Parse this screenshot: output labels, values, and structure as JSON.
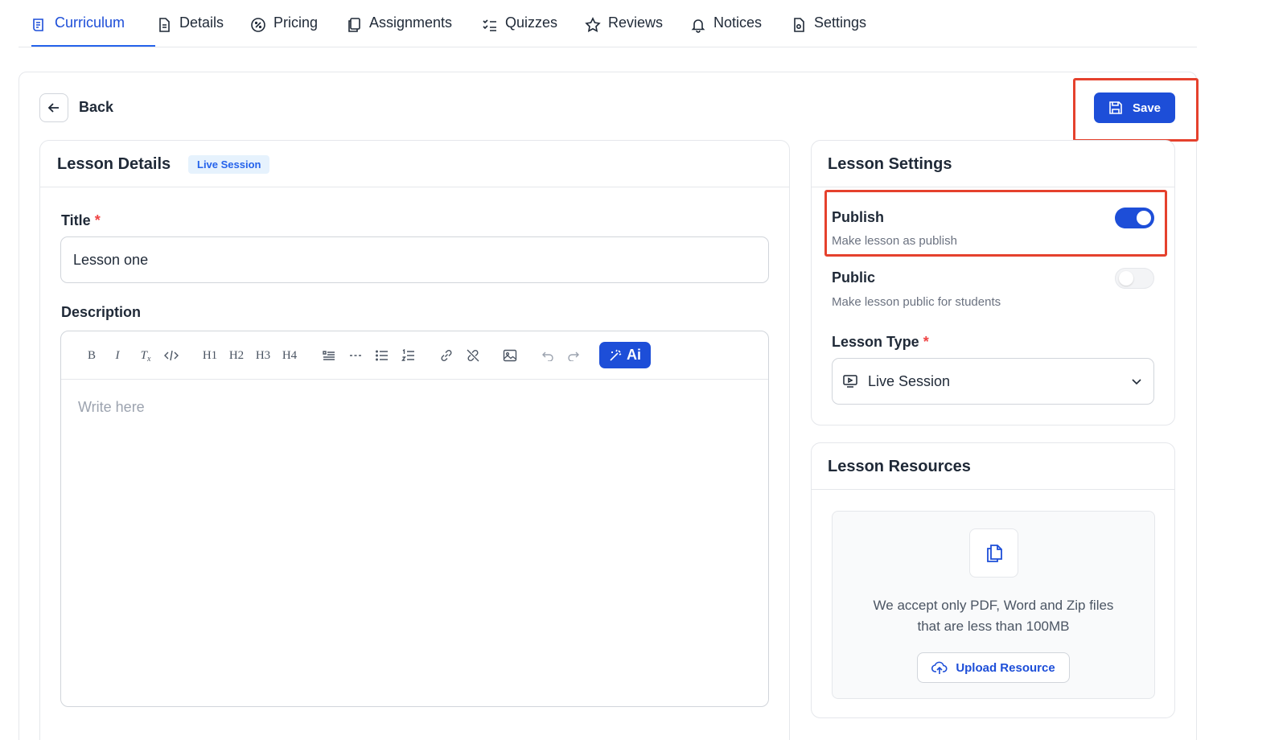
{
  "tabs": [
    {
      "label": "Curriculum",
      "icon": "curriculum-icon",
      "active": true
    },
    {
      "label": "Details",
      "icon": "document-icon"
    },
    {
      "label": "Pricing",
      "icon": "discount-icon"
    },
    {
      "label": "Assignments",
      "icon": "copy-icon"
    },
    {
      "label": "Quizzes",
      "icon": "checklist-icon"
    },
    {
      "label": "Reviews",
      "icon": "star-icon"
    },
    {
      "label": "Notices",
      "icon": "bell-icon"
    },
    {
      "label": "Settings",
      "icon": "settings-file-icon"
    }
  ],
  "header": {
    "back_label": "Back",
    "save_label": "Save"
  },
  "lesson_details": {
    "title": "Lesson Details",
    "badge": "Live Session",
    "title_label": "Title",
    "required_mark": "*",
    "title_value": "Lesson one",
    "description_label": "Description",
    "description_placeholder": "Write here",
    "toolbar": {
      "ai_label": "Ai",
      "h1": "H1",
      "h2": "H2",
      "h3": "H3",
      "h4": "H4",
      "bold": "B",
      "italic": "I",
      "clear": "T"
    }
  },
  "lesson_settings": {
    "title": "Lesson Settings",
    "publish": {
      "title": "Publish",
      "subtitle": "Make lesson as publish",
      "enabled": true
    },
    "public": {
      "title": "Public",
      "subtitle": "Make lesson public for students",
      "enabled": false
    },
    "type_label": "Lesson Type",
    "required_mark": "*",
    "type_value": "Live Session"
  },
  "lesson_resources": {
    "title": "Lesson Resources",
    "text_line1": "We accept only PDF, Word and Zip files",
    "text_line2": "that are less than 100MB",
    "upload_label": "Upload Resource"
  },
  "colors": {
    "accent": "#1d4ed8",
    "highlight": "#e5412d",
    "required": "#ef4444"
  }
}
